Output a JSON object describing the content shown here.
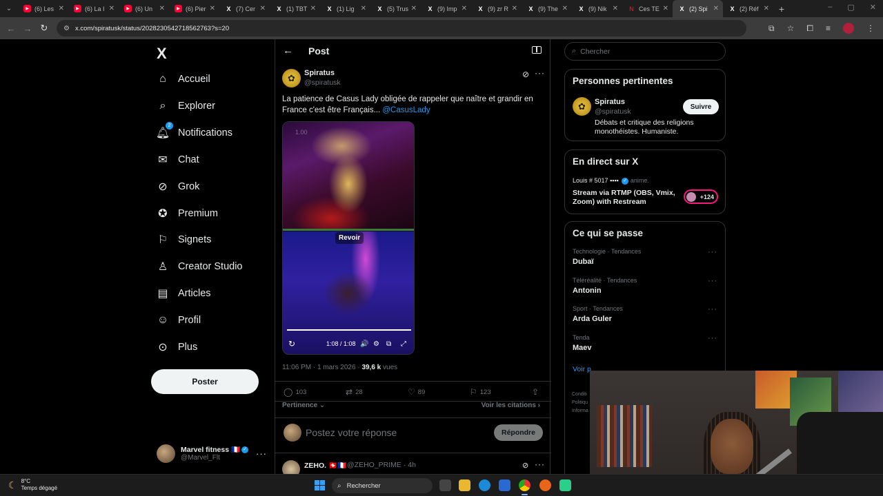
{
  "browser": {
    "tabs": [
      {
        "label": "(6) Les",
        "favicon": "youtube",
        "active": false
      },
      {
        "label": "(6) La I",
        "favicon": "youtube",
        "active": false
      },
      {
        "label": "(6) Un",
        "favicon": "youtube",
        "active": false
      },
      {
        "label": "(6) Pier",
        "favicon": "youtube",
        "active": false
      },
      {
        "label": "(7) Cer",
        "favicon": "x",
        "active": false
      },
      {
        "label": "(1) TBT",
        "favicon": "x",
        "active": false
      },
      {
        "label": "(1) Lig",
        "favicon": "x",
        "active": false
      },
      {
        "label": "(5) Trus",
        "favicon": "x",
        "active": false
      },
      {
        "label": "(9) Imp",
        "favicon": "x",
        "active": false
      },
      {
        "label": "(9) zr R",
        "favicon": "x",
        "active": false
      },
      {
        "label": "(9) The",
        "favicon": "x",
        "active": false
      },
      {
        "label": "(9) Nik",
        "favicon": "x",
        "active": false
      },
      {
        "label": "Ces TE",
        "favicon": "n",
        "active": false
      },
      {
        "label": "(2) Spi",
        "favicon": "x",
        "active": true
      },
      {
        "label": "(2) Réf",
        "favicon": "x",
        "active": false
      }
    ],
    "url": "x.com/spiratusk/status/2028230542718562763?s=20"
  },
  "sidebar": {
    "logo": "X",
    "items": [
      {
        "label": "Accueil",
        "icon": "home-icon"
      },
      {
        "label": "Explorer",
        "icon": "search-icon"
      },
      {
        "label": "Notifications",
        "icon": "bell-icon",
        "badge": "2"
      },
      {
        "label": "Chat",
        "icon": "mail-icon"
      },
      {
        "label": "Grok",
        "icon": "grok-icon"
      },
      {
        "label": "Premium",
        "icon": "premium-icon"
      },
      {
        "label": "Signets",
        "icon": "bookmark-icon"
      },
      {
        "label": "Creator Studio",
        "icon": "flask-icon"
      },
      {
        "label": "Articles",
        "icon": "article-icon"
      },
      {
        "label": "Profil",
        "icon": "user-icon"
      },
      {
        "label": "Plus",
        "icon": "more-circle-icon"
      }
    ],
    "post_button": "Poster",
    "account": {
      "name": "Marvel fitness 🇫🇷",
      "handle": "@Marvel_Flt"
    }
  },
  "main": {
    "header_title": "Post",
    "tweet": {
      "author_name": "Spiratus",
      "author_handle": "@spiratusk",
      "text": "La patience de Casus Lady obligée de rappeler que naître et grandir en France c'est être Français...",
      "mention": "@CasusLady",
      "video": {
        "overlay_label": "1.00",
        "replay_label": "Revoir",
        "time": "1:08 / 1:08",
        "progress": 1.0
      },
      "time": "11:06 PM",
      "date": "1 mars 2026",
      "views_count": "39,6 k",
      "views_label": "vues",
      "stats": {
        "replies": "103",
        "reposts": "28",
        "likes": "89",
        "bookmarks": "123"
      }
    },
    "sort_label": "Pertinence",
    "quotes_link": "Voir les citations",
    "reply_placeholder": "Postez votre réponse",
    "reply_button": "Répondre",
    "next_reply": {
      "name": "ZEHO. 🇨🇭🇫🇷",
      "handle": "@ZEHO_PRIME · 4h"
    }
  },
  "right": {
    "search_placeholder": "Chercher",
    "relevant": {
      "title": "Personnes pertinentes",
      "name": "Spiratus",
      "handle": "@spiratusk",
      "follow": "Suivre",
      "bio": "Débats et critique des religions monothéistes. Humaniste."
    },
    "live": {
      "title": "En direct sur X",
      "host_line": "Louis # 5017",
      "host_suffix": "anime.",
      "stream_title": "Stream via RTMP (OBS, Vmix, Zoom) with Restream",
      "listeners": "+124"
    },
    "trending": {
      "title": "Ce qui se passe",
      "items": [
        {
          "category": "Technologie · Tendances",
          "name": "Dubaï"
        },
        {
          "category": "Téléréalité · Tendances",
          "name": "Antonin"
        },
        {
          "category": "Sport · Tendances",
          "name": "Arda Guler"
        },
        {
          "category": "Tenda",
          "name": "Maev"
        }
      ],
      "show_more": "Voir p",
      "footer": [
        "Conditi",
        "Politiqu",
        "Informa"
      ]
    }
  },
  "taskbar": {
    "temperature": "8°C",
    "weather": "Temps dégagé",
    "search": "Rechercher"
  },
  "colors": {
    "accent": "#1d9bf0",
    "background": "#000000",
    "border": "#2f3336",
    "text_secondary": "#71767b",
    "live_pink": "#f91880"
  }
}
